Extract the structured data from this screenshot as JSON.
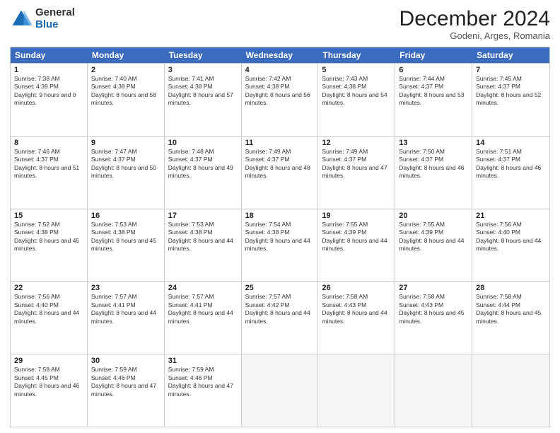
{
  "logo": {
    "general": "General",
    "blue": "Blue"
  },
  "title": "December 2024",
  "subtitle": "Godeni, Arges, Romania",
  "days": [
    "Sunday",
    "Monday",
    "Tuesday",
    "Wednesday",
    "Thursday",
    "Friday",
    "Saturday"
  ],
  "weeks": [
    [
      {
        "day": "1",
        "sunrise": "Sunrise: 7:38 AM",
        "sunset": "Sunset: 4:39 PM",
        "daylight": "Daylight: 9 hours and 0 minutes."
      },
      {
        "day": "2",
        "sunrise": "Sunrise: 7:40 AM",
        "sunset": "Sunset: 4:38 PM",
        "daylight": "Daylight: 8 hours and 58 minutes."
      },
      {
        "day": "3",
        "sunrise": "Sunrise: 7:41 AM",
        "sunset": "Sunset: 4:38 PM",
        "daylight": "Daylight: 8 hours and 57 minutes."
      },
      {
        "day": "4",
        "sunrise": "Sunrise: 7:42 AM",
        "sunset": "Sunset: 4:38 PM",
        "daylight": "Daylight: 8 hours and 56 minutes."
      },
      {
        "day": "5",
        "sunrise": "Sunrise: 7:43 AM",
        "sunset": "Sunset: 4:38 PM",
        "daylight": "Daylight: 8 hours and 54 minutes."
      },
      {
        "day": "6",
        "sunrise": "Sunrise: 7:44 AM",
        "sunset": "Sunset: 4:37 PM",
        "daylight": "Daylight: 8 hours and 53 minutes."
      },
      {
        "day": "7",
        "sunrise": "Sunrise: 7:45 AM",
        "sunset": "Sunset: 4:37 PM",
        "daylight": "Daylight: 8 hours and 52 minutes."
      }
    ],
    [
      {
        "day": "8",
        "sunrise": "Sunrise: 7:46 AM",
        "sunset": "Sunset: 4:37 PM",
        "daylight": "Daylight: 8 hours and 51 minutes."
      },
      {
        "day": "9",
        "sunrise": "Sunrise: 7:47 AM",
        "sunset": "Sunset: 4:37 PM",
        "daylight": "Daylight: 8 hours and 50 minutes."
      },
      {
        "day": "10",
        "sunrise": "Sunrise: 7:48 AM",
        "sunset": "Sunset: 4:37 PM",
        "daylight": "Daylight: 8 hours and 49 minutes."
      },
      {
        "day": "11",
        "sunrise": "Sunrise: 7:49 AM",
        "sunset": "Sunset: 4:37 PM",
        "daylight": "Daylight: 8 hours and 48 minutes."
      },
      {
        "day": "12",
        "sunrise": "Sunrise: 7:49 AM",
        "sunset": "Sunset: 4:37 PM",
        "daylight": "Daylight: 8 hours and 47 minutes."
      },
      {
        "day": "13",
        "sunrise": "Sunrise: 7:50 AM",
        "sunset": "Sunset: 4:37 PM",
        "daylight": "Daylight: 8 hours and 46 minutes."
      },
      {
        "day": "14",
        "sunrise": "Sunrise: 7:51 AM",
        "sunset": "Sunset: 4:37 PM",
        "daylight": "Daylight: 8 hours and 46 minutes."
      }
    ],
    [
      {
        "day": "15",
        "sunrise": "Sunrise: 7:52 AM",
        "sunset": "Sunset: 4:38 PM",
        "daylight": "Daylight: 8 hours and 45 minutes."
      },
      {
        "day": "16",
        "sunrise": "Sunrise: 7:53 AM",
        "sunset": "Sunset: 4:38 PM",
        "daylight": "Daylight: 8 hours and 45 minutes."
      },
      {
        "day": "17",
        "sunrise": "Sunrise: 7:53 AM",
        "sunset": "Sunset: 4:38 PM",
        "daylight": "Daylight: 8 hours and 44 minutes."
      },
      {
        "day": "18",
        "sunrise": "Sunrise: 7:54 AM",
        "sunset": "Sunset: 4:38 PM",
        "daylight": "Daylight: 8 hours and 44 minutes."
      },
      {
        "day": "19",
        "sunrise": "Sunrise: 7:55 AM",
        "sunset": "Sunset: 4:39 PM",
        "daylight": "Daylight: 8 hours and 44 minutes."
      },
      {
        "day": "20",
        "sunrise": "Sunrise: 7:55 AM",
        "sunset": "Sunset: 4:39 PM",
        "daylight": "Daylight: 8 hours and 44 minutes."
      },
      {
        "day": "21",
        "sunrise": "Sunrise: 7:56 AM",
        "sunset": "Sunset: 4:40 PM",
        "daylight": "Daylight: 8 hours and 44 minutes."
      }
    ],
    [
      {
        "day": "22",
        "sunrise": "Sunrise: 7:56 AM",
        "sunset": "Sunset: 4:40 PM",
        "daylight": "Daylight: 8 hours and 44 minutes."
      },
      {
        "day": "23",
        "sunrise": "Sunrise: 7:57 AM",
        "sunset": "Sunset: 4:41 PM",
        "daylight": "Daylight: 8 hours and 44 minutes."
      },
      {
        "day": "24",
        "sunrise": "Sunrise: 7:57 AM",
        "sunset": "Sunset: 4:41 PM",
        "daylight": "Daylight: 8 hours and 44 minutes."
      },
      {
        "day": "25",
        "sunrise": "Sunrise: 7:57 AM",
        "sunset": "Sunset: 4:42 PM",
        "daylight": "Daylight: 8 hours and 44 minutes."
      },
      {
        "day": "26",
        "sunrise": "Sunrise: 7:58 AM",
        "sunset": "Sunset: 4:43 PM",
        "daylight": "Daylight: 8 hours and 44 minutes."
      },
      {
        "day": "27",
        "sunrise": "Sunrise: 7:58 AM",
        "sunset": "Sunset: 4:43 PM",
        "daylight": "Daylight: 8 hours and 45 minutes."
      },
      {
        "day": "28",
        "sunrise": "Sunrise: 7:58 AM",
        "sunset": "Sunset: 4:44 PM",
        "daylight": "Daylight: 8 hours and 45 minutes."
      }
    ],
    [
      {
        "day": "29",
        "sunrise": "Sunrise: 7:58 AM",
        "sunset": "Sunset: 4:45 PM",
        "daylight": "Daylight: 8 hours and 46 minutes."
      },
      {
        "day": "30",
        "sunrise": "Sunrise: 7:59 AM",
        "sunset": "Sunset: 4:46 PM",
        "daylight": "Daylight: 8 hours and 47 minutes."
      },
      {
        "day": "31",
        "sunrise": "Sunrise: 7:59 AM",
        "sunset": "Sunset: 4:46 PM",
        "daylight": "Daylight: 8 hours and 47 minutes."
      },
      null,
      null,
      null,
      null
    ]
  ]
}
